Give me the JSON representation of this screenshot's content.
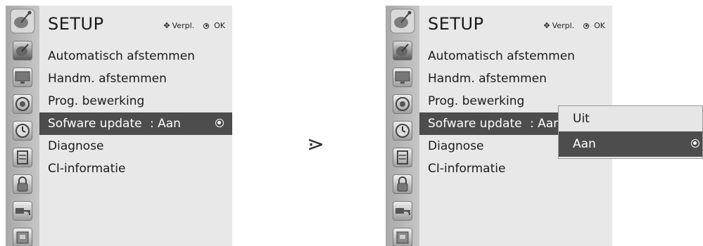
{
  "left_screen": {
    "title": "SETUP",
    "hint_move": "Verpl.",
    "hint_ok": "OK",
    "items": [
      {
        "label": "Automatisch afstemmen"
      },
      {
        "label": "Handm. afstemmen"
      },
      {
        "label": "Prog. bewerking"
      },
      {
        "label": "Sofware update",
        "value": ": Aan",
        "selected": true
      },
      {
        "label": "Diagnose"
      },
      {
        "label": "CI-informatie"
      }
    ],
    "icons": [
      "setup-icon",
      "picture-icon",
      "audio-icon",
      "time-icon",
      "option-icon",
      "lock-icon",
      "input-icon",
      "usb-icon"
    ]
  },
  "transition_arrow": "⋗",
  "right_screen": {
    "title": "SETUP",
    "hint_move": "Verpl.",
    "hint_ok": "OK",
    "items": [
      {
        "label": "Automatisch afstemmen"
      },
      {
        "label": "Handm. afstemmen"
      },
      {
        "label": "Prog. bewerking"
      },
      {
        "label": "Sofware update",
        "value": ": Aan",
        "selected": true
      },
      {
        "label": "Diagnose"
      },
      {
        "label": "CI-informatie"
      }
    ],
    "popup_options": [
      {
        "label": "Uit",
        "selected": false
      },
      {
        "label": "Aan",
        "selected": true
      }
    ]
  },
  "colors": {
    "menu_bg": "#e8e8e8",
    "highlight": "#4d4d4d",
    "iconbar": "#b5b5b5"
  }
}
